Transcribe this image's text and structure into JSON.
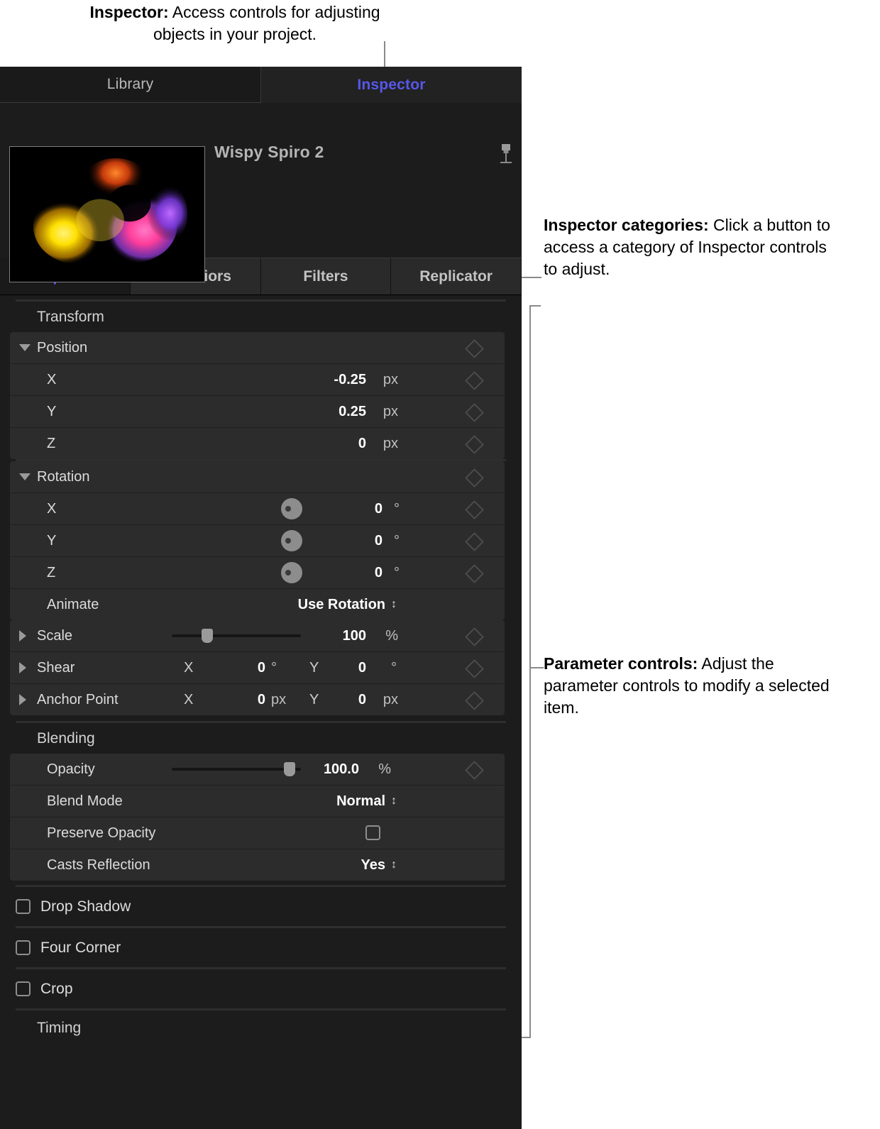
{
  "callouts": {
    "inspector": {
      "bold": "Inspector:",
      "text": " Access controls for adjusting objects in your project."
    },
    "categories": {
      "bold": "Inspector categories:",
      "text": " Click a button to access a category of Inspector controls to adjust."
    },
    "parameters": {
      "bold": "Parameter controls:",
      "text": " Adjust the parameter controls to modify a selected item."
    }
  },
  "panel": {
    "top_tabs": [
      {
        "label": "Library",
        "active": false
      },
      {
        "label": "Inspector",
        "active": true
      }
    ],
    "object_title": "Wispy Spiro 2",
    "pin_icon": "pushpin-icon",
    "category_tabs": [
      {
        "label": "Properties",
        "active": true
      },
      {
        "label": "Behaviors",
        "active": false
      },
      {
        "label": "Filters",
        "active": false
      },
      {
        "label": "Replicator",
        "active": false
      }
    ],
    "groups": {
      "transform": {
        "title": "Transform",
        "position": {
          "label": "Position",
          "disclosure": "open",
          "rows": [
            {
              "label": "X",
              "value": "-0.25",
              "unit": "px"
            },
            {
              "label": "Y",
              "value": "0.25",
              "unit": "px"
            },
            {
              "label": "Z",
              "value": "0",
              "unit": "px"
            }
          ]
        },
        "rotation": {
          "label": "Rotation",
          "disclosure": "open",
          "rows": [
            {
              "label": "X",
              "value": "0",
              "unit": "°"
            },
            {
              "label": "Y",
              "value": "0",
              "unit": "°"
            },
            {
              "label": "Z",
              "value": "0",
              "unit": "°"
            }
          ],
          "animate": {
            "label": "Animate",
            "value": "Use Rotation"
          }
        },
        "scale": {
          "label": "Scale",
          "disclosure": "closed",
          "value": "100",
          "unit": "%",
          "slider_percent": 27
        },
        "shear": {
          "label": "Shear",
          "disclosure": "closed",
          "x_tag": "X",
          "x_value": "0",
          "x_unit": "°",
          "y_tag": "Y",
          "y_value": "0",
          "y_unit": "°"
        },
        "anchor_point": {
          "label": "Anchor Point",
          "disclosure": "closed",
          "x_tag": "X",
          "x_value": "0",
          "x_unit": "px",
          "y_tag": "Y",
          "y_value": "0",
          "y_unit": "px"
        }
      },
      "blending": {
        "title": "Blending",
        "opacity": {
          "label": "Opacity",
          "value": "100.0",
          "unit": "%",
          "slider_percent": 88
        },
        "blend_mode": {
          "label": "Blend Mode",
          "value": "Normal"
        },
        "preserve_opacity": {
          "label": "Preserve Opacity",
          "checked": false
        },
        "casts_reflection": {
          "label": "Casts Reflection",
          "value": "Yes"
        }
      },
      "toggles": [
        {
          "label": "Drop Shadow",
          "checked": false
        },
        {
          "label": "Four Corner",
          "checked": false
        },
        {
          "label": "Crop",
          "checked": false
        }
      ],
      "timing": {
        "title": "Timing"
      }
    }
  },
  "colors": {
    "accent": "#5757ea",
    "panel_bg": "#1c1c1c",
    "row_bg": "#2c2c2c",
    "text": "#dcdcdc"
  }
}
